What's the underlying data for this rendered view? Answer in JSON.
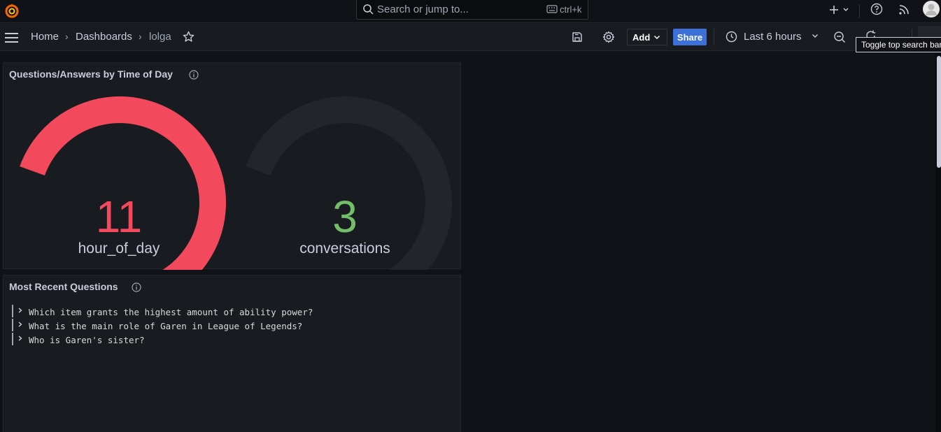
{
  "search": {
    "placeholder": "Search or jump to...",
    "shortcut": "ctrl+k"
  },
  "breadcrumb": {
    "home": "Home",
    "dashboards": "Dashboards",
    "current": "lolga"
  },
  "toolbar": {
    "add_label": "Add",
    "share_label": "Share",
    "time_range": "Last 6 hours"
  },
  "tooltip": {
    "text": "Toggle top search bar"
  },
  "panels": {
    "gauge_panel": {
      "title": "Questions/Answers by Time of Day",
      "gauges": [
        {
          "value": "11",
          "label": "hour_of_day",
          "color": "#f2495c",
          "fill": 1.0
        },
        {
          "value": "3",
          "label": "conversations",
          "color": "#73bf69",
          "fill": 0.0
        }
      ]
    },
    "questions_panel": {
      "title": "Most Recent Questions",
      "items": [
        "Which item grants the highest amount of ability power?",
        "What is the main role of Garen in League of Legends?",
        "Who is Garen's sister?"
      ]
    }
  },
  "colors": {
    "background": "#111217",
    "panel": "#181b1f",
    "accent": "#3d71d9",
    "gauge_track": "#22252b"
  },
  "icons": [
    "grafana-logo-icon",
    "search-icon",
    "keyboard-icon",
    "plus-icon",
    "chevron-down-icon",
    "help-icon",
    "rss-icon",
    "avatar",
    "menu-icon",
    "star-icon",
    "save-icon",
    "gear-icon",
    "clock-icon",
    "zoom-out-icon",
    "refresh-icon",
    "info-icon",
    "chevron-right-icon"
  ]
}
